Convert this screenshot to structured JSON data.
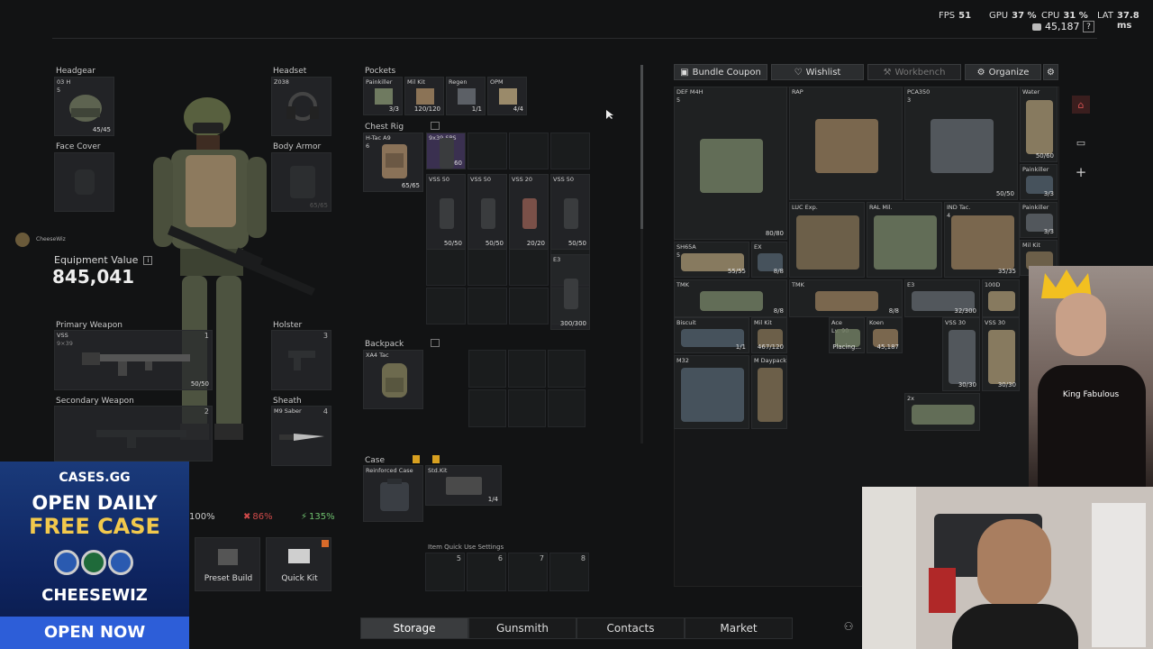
{
  "hud": {
    "fps_label": "FPS",
    "fps": "51",
    "gpu_label": "GPU",
    "gpu": "37 %",
    "cpu_label": "CPU",
    "cpu": "31 %",
    "lat_label": "LAT",
    "lat": "37.8 ms",
    "currency": "45,187",
    "help": "?"
  },
  "equipment": {
    "headgear": {
      "label": "Headgear",
      "item": "03 H",
      "level": "5",
      "durability": "45/45"
    },
    "headset": {
      "label": "Headset",
      "item": "Z038"
    },
    "face_cover": {
      "label": "Face Cover"
    },
    "body_armor": {
      "label": "Body Armor",
      "ghost": "65/65"
    },
    "player_name": "CheeseWiz",
    "value_label": "Equipment Value",
    "value": "845,041",
    "primary": {
      "label": "Primary Weapon",
      "item": "VSS",
      "sub": "9×39",
      "num": "1",
      "ammo": "50/50"
    },
    "holster": {
      "label": "Holster",
      "num": "3"
    },
    "secondary": {
      "label": "Secondary Weapon",
      "num": "2"
    },
    "sheath": {
      "label": "Sheath",
      "item": "M9 Saber",
      "num": "4"
    },
    "stats": {
      "weight": "100%",
      "health": "86%",
      "energy": "135%"
    },
    "preset_build": "Preset Build",
    "quick_kit": "Quick Kit"
  },
  "pockets": {
    "label": "Pockets",
    "items": [
      {
        "name": "Painkiller",
        "count": "3/3"
      },
      {
        "name": "Mil Kit",
        "count": "120/120"
      },
      {
        "name": "Regen",
        "count": "1/1"
      },
      {
        "name": "OPM",
        "count": "4/4"
      }
    ]
  },
  "chest_rig": {
    "label": "Chest Rig",
    "item": "H-Tac A9",
    "level": "6",
    "durability": "65/65",
    "slots": [
      {
        "name": "9x39 SPS",
        "count": "60"
      },
      {
        "name": "VSS 50",
        "count": "50/50"
      },
      {
        "name": "VSS 50",
        "count": "50/50"
      },
      {
        "name": "VSS 20",
        "count": "20/20"
      },
      {
        "name": "VSS 50",
        "count": "50/50"
      },
      {
        "name": "E3",
        "count": "300/300"
      }
    ]
  },
  "backpack": {
    "label": "Backpack",
    "item": "XA4 Tac"
  },
  "case": {
    "label": "Case",
    "item": "Reinforced Case",
    "kit_name": "Std.Kit",
    "kit_count": "1/4"
  },
  "quick_use": {
    "label": "Item Quick Use Settings",
    "slots": [
      "5",
      "6",
      "7",
      "8"
    ]
  },
  "toolbar": {
    "bundle": "Bundle Coupon",
    "wishlist": "Wishlist",
    "workbench": "Workbench",
    "organize": "Organize"
  },
  "storage": {
    "items": [
      {
        "name": "DEF M4H",
        "sub": "5",
        "count": "80/80"
      },
      {
        "name": "RAP",
        "count": ""
      },
      {
        "name": "PCA350",
        "sub": "3",
        "count": "50/50"
      },
      {
        "name": "Water",
        "count": "50/60"
      },
      {
        "name": "Painkiller",
        "count": "3/3"
      },
      {
        "name": "LUC Exp.",
        "count": ""
      },
      {
        "name": "RAL Mil.",
        "count": ""
      },
      {
        "name": "IND Tac.",
        "sub": "4",
        "count": "35/35"
      },
      {
        "name": "Painkiller",
        "count": "3/3"
      },
      {
        "name": "SH65A",
        "sub": "5",
        "count": "55/55"
      },
      {
        "name": "EX",
        "count": "8/8"
      },
      {
        "name": "Mil Kit",
        "count": ""
      },
      {
        "name": "TMK",
        "count": "8/8"
      },
      {
        "name": "TMK",
        "count": "8/8"
      },
      {
        "name": "E3",
        "count": "32/300"
      },
      {
        "name": "100D",
        "count": ""
      },
      {
        "name": "Biscuit",
        "count": "1/1"
      },
      {
        "name": "Mil Kit",
        "count": "467/120"
      },
      {
        "name": "Ace",
        "sub": "Lv. 90",
        "count": "Placing..."
      },
      {
        "name": "Koen",
        "count": "45,187"
      },
      {
        "name": "VSS 30",
        "count": "30/30"
      },
      {
        "name": "VSS 30",
        "count": "30/30"
      },
      {
        "name": "M32",
        "count": ""
      },
      {
        "name": "M Daypack",
        "count": ""
      },
      {
        "name": "2x",
        "count": ""
      }
    ]
  },
  "tabs": [
    "Storage",
    "Gunsmith",
    "Contacts",
    "Market"
  ],
  "overlays": {
    "webcam_name": "King Fabulous",
    "ad_brand": "CASES.GG",
    "ad_line1": "OPEN DAILY",
    "ad_line2": "FREE CASE",
    "ad_code": "CHEESEWIZ",
    "ad_cta": "OPEN NOW"
  },
  "colors": {
    "accent_gold": "#d8a020",
    "health_red": "#d04a4a",
    "energy_green": "#6fc06f",
    "ad_yellow": "#f2c94c"
  }
}
